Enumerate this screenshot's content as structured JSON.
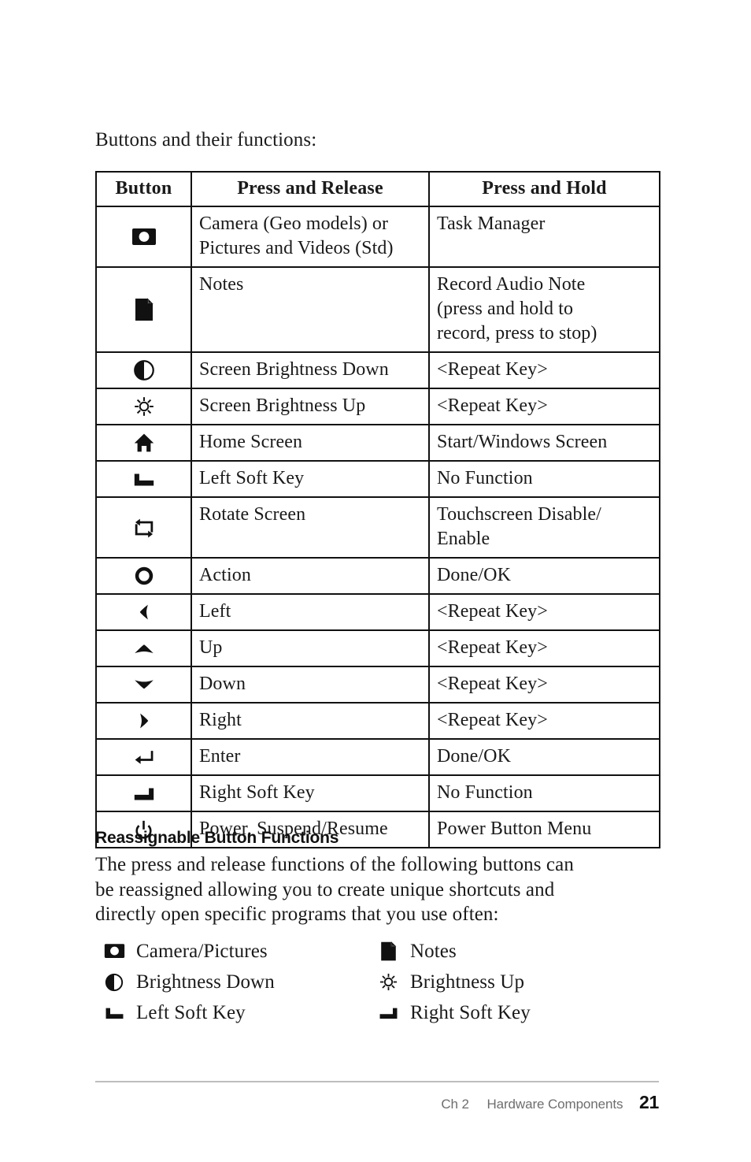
{
  "intro": "Buttons and their functions:",
  "table": {
    "headers": [
      "Button",
      "Press and Release",
      "Press and Hold"
    ],
    "rows": [
      {
        "icon": "camera-icon",
        "press_release": [
          "Camera (Geo models) or",
          "Pictures and Videos (Std)"
        ],
        "press_hold": [
          "Task Manager"
        ]
      },
      {
        "icon": "note-page-icon",
        "press_release": [
          "Notes"
        ],
        "press_hold": [
          "Record Audio Note",
          "(press and hold to",
          "record, press to stop)"
        ]
      },
      {
        "icon": "brightness-down-icon",
        "press_release": [
          "Screen Brightness Down"
        ],
        "press_hold": [
          "<Repeat Key>"
        ]
      },
      {
        "icon": "brightness-up-icon",
        "press_release": [
          "Screen Brightness Up"
        ],
        "press_hold": [
          "<Repeat Key>"
        ]
      },
      {
        "icon": "home-icon",
        "press_release": [
          "Home Screen"
        ],
        "press_hold": [
          "Start/Windows Screen"
        ]
      },
      {
        "icon": "left-soft-key-icon",
        "press_release": [
          "Left Soft Key"
        ],
        "press_hold": [
          "No Function"
        ]
      },
      {
        "icon": "rotate-screen-icon",
        "press_release": [
          "Rotate Screen"
        ],
        "press_hold": [
          "Touchscreen Disable/",
          "Enable"
        ]
      },
      {
        "icon": "action-circle-icon",
        "press_release": [
          "Action"
        ],
        "press_hold": [
          "Done/OK"
        ]
      },
      {
        "icon": "arrow-left-icon",
        "press_release": [
          "Left"
        ],
        "press_hold": [
          "<Repeat Key>"
        ]
      },
      {
        "icon": "arrow-up-icon",
        "press_release": [
          "Up"
        ],
        "press_hold": [
          "<Repeat Key>"
        ]
      },
      {
        "icon": "arrow-down-icon",
        "press_release": [
          "Down"
        ],
        "press_hold": [
          "<Repeat Key>"
        ]
      },
      {
        "icon": "arrow-right-icon",
        "press_release": [
          "Right"
        ],
        "press_hold": [
          "<Repeat Key>"
        ]
      },
      {
        "icon": "enter-icon",
        "press_release": [
          "Enter"
        ],
        "press_hold": [
          "Done/OK"
        ]
      },
      {
        "icon": "right-soft-key-icon",
        "press_release": [
          "Right Soft Key"
        ],
        "press_hold": [
          "No Function"
        ]
      },
      {
        "icon": "power-icon",
        "press_release": [
          "Power, Suspend/Resume"
        ],
        "press_hold": [
          "Power Button Menu"
        ]
      }
    ]
  },
  "reassignable": {
    "heading": "Reassignable Button Functions",
    "body": [
      "The press and release functions of the following buttons can",
      "be reassigned allowing you to create unique shortcuts and",
      "directly open specific programs that you use often:"
    ],
    "items": [
      {
        "icon": "camera-icon",
        "label": "Camera/Pictures"
      },
      {
        "icon": "note-page-icon",
        "label": "Notes"
      },
      {
        "icon": "brightness-down-icon",
        "label": "Brightness Down"
      },
      {
        "icon": "brightness-up-icon",
        "label": "Brightness Up"
      },
      {
        "icon": "left-soft-key-icon",
        "label": "Left Soft Key"
      },
      {
        "icon": "right-soft-key-icon",
        "label": "Right Soft Key"
      }
    ]
  },
  "footer": {
    "chapter": "Ch 2",
    "section": "Hardware Components",
    "page_number": "21"
  },
  "colors": {
    "text": "#1a1a1a",
    "rule": "#bdbdbd",
    "footer_text": "#6e6e6e",
    "border": "#111111"
  }
}
